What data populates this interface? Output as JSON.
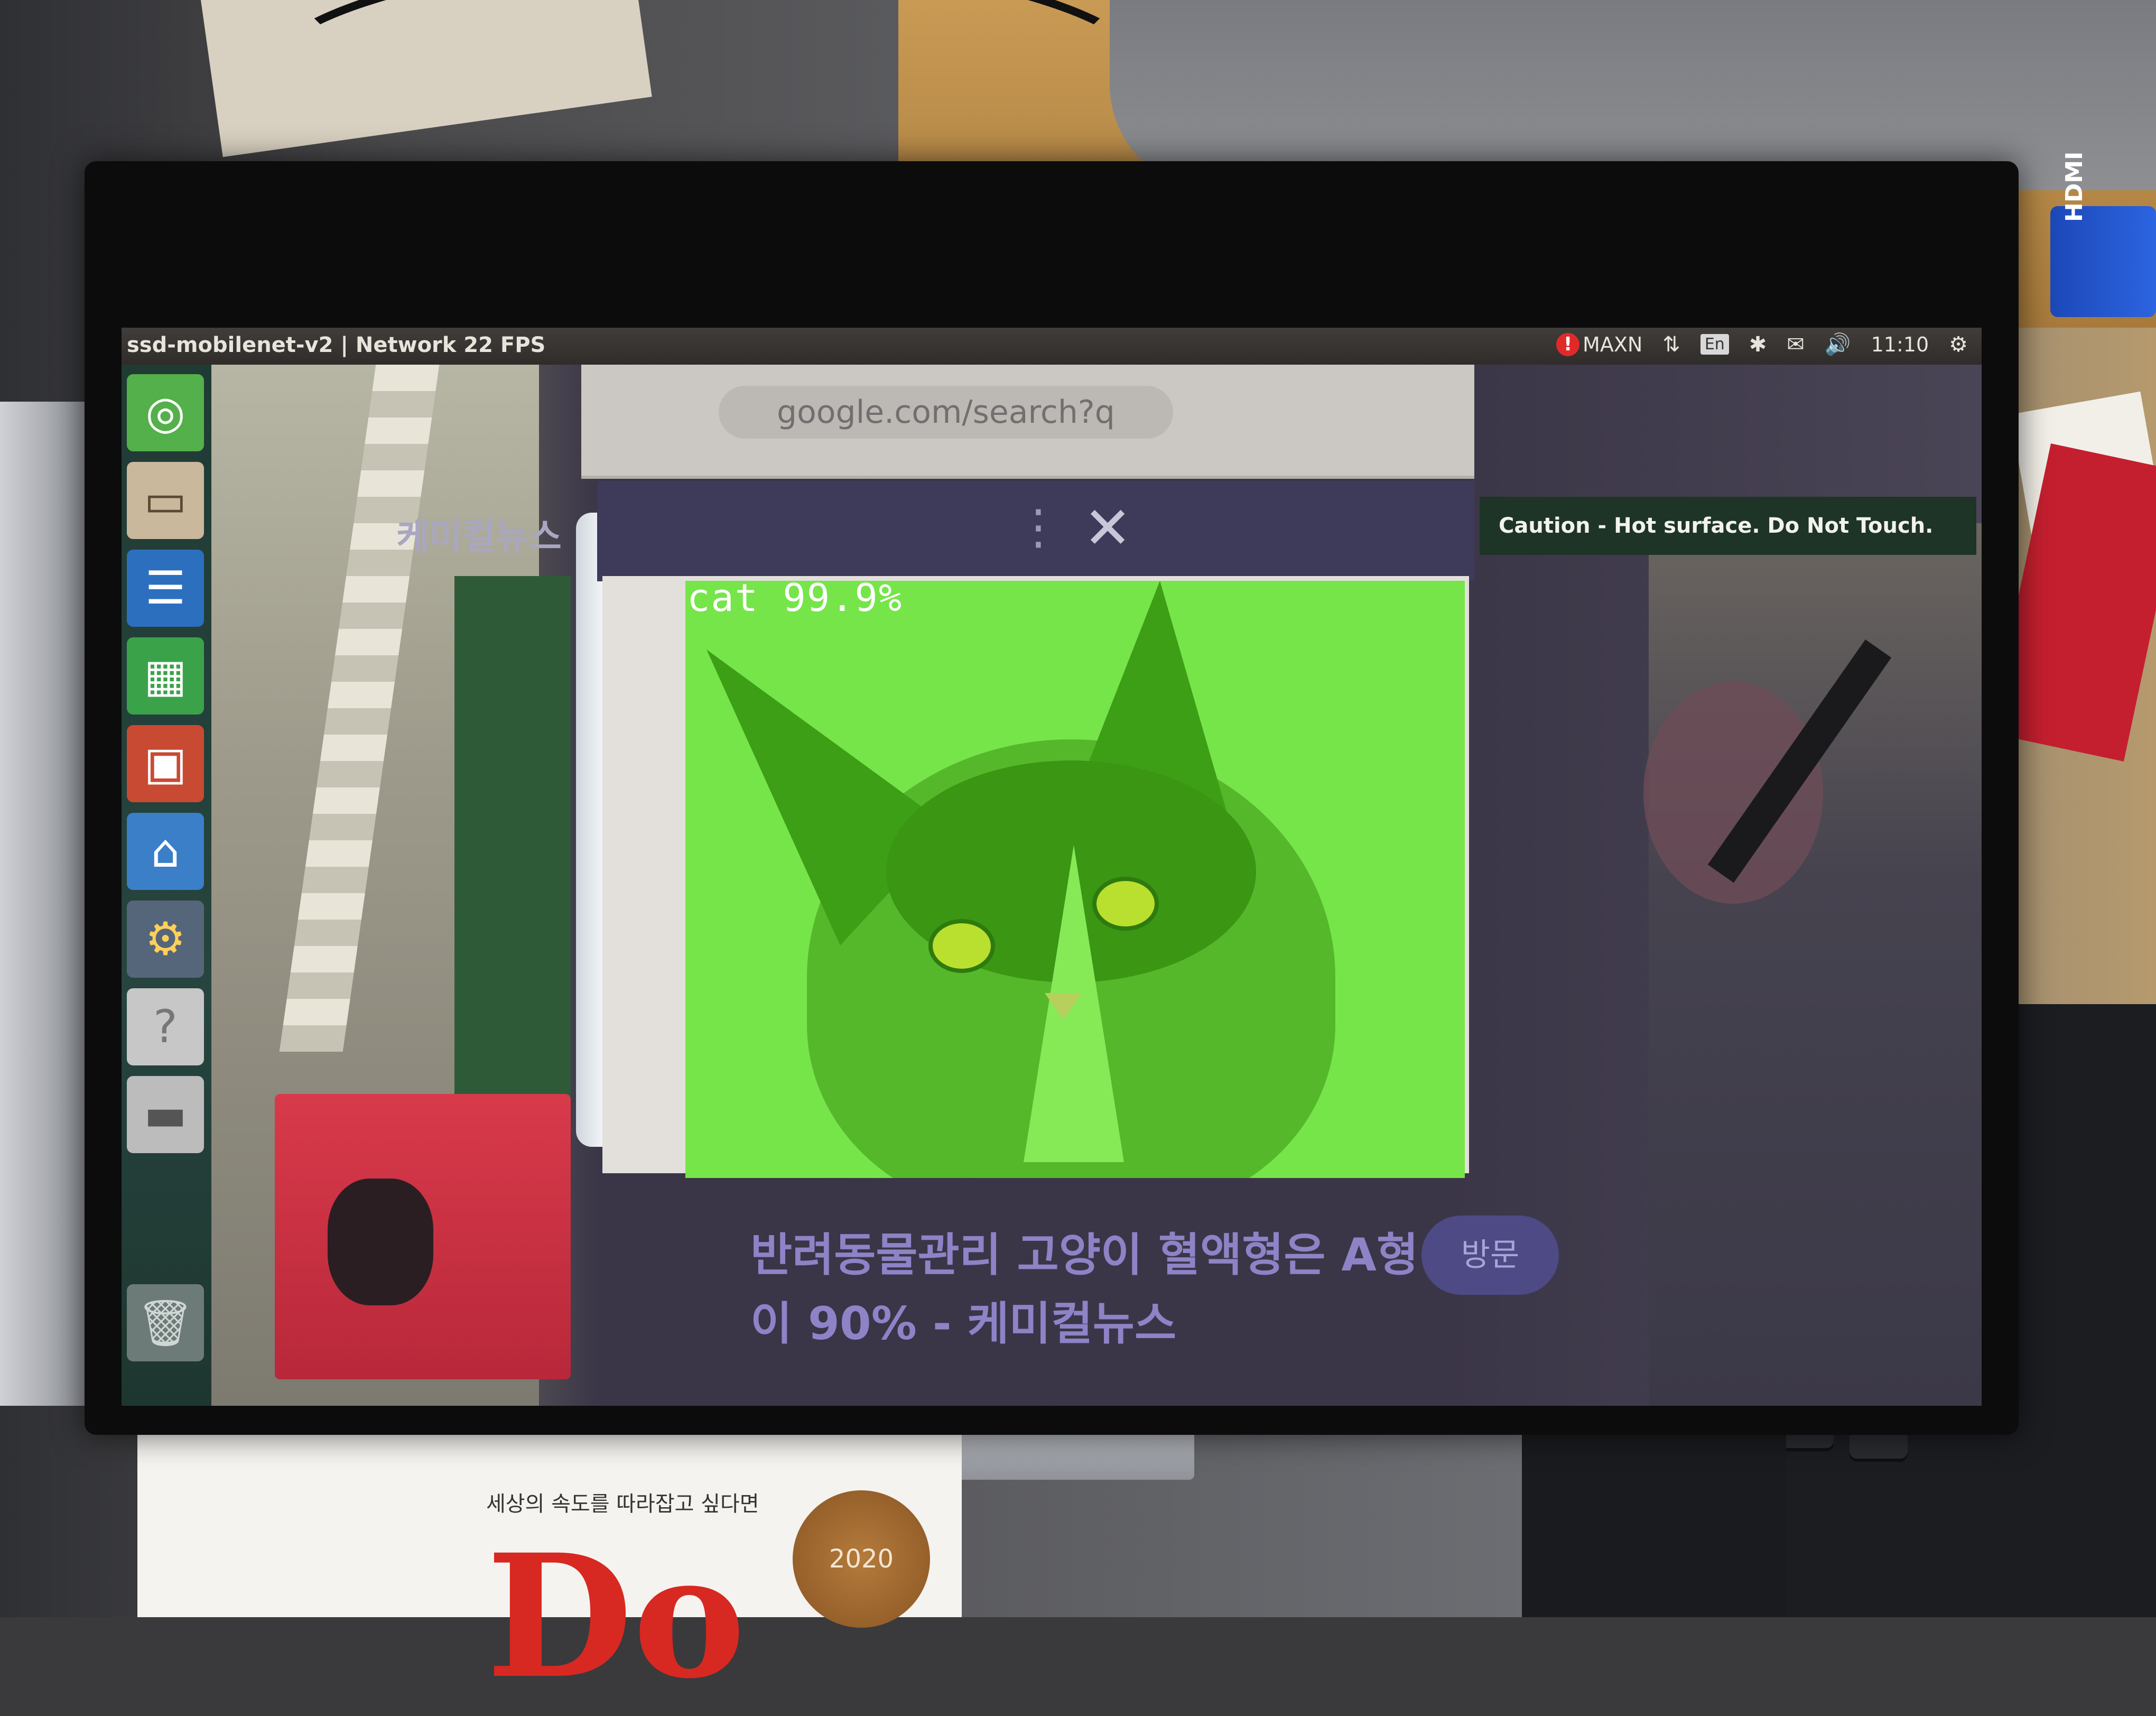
{
  "window": {
    "title": "ssd-mobilenet-v2 | Network 22 FPS"
  },
  "panel": {
    "power_mode": "MAXN",
    "keyboard_layout": "En",
    "clock": "11:10",
    "alert_icon": "!",
    "indicators": [
      "network-icon",
      "bluetooth-icon",
      "mail-icon",
      "volume-icon",
      "gear-icon"
    ]
  },
  "launcher": {
    "items": [
      {
        "name": "dash",
        "glyph": "◎"
      },
      {
        "name": "files",
        "glyph": "▭"
      },
      {
        "name": "writer",
        "glyph": "☰"
      },
      {
        "name": "calc",
        "glyph": "▦"
      },
      {
        "name": "impress",
        "glyph": "▣"
      },
      {
        "name": "software",
        "glyph": "⌂"
      },
      {
        "name": "settings",
        "glyph": "⚙"
      },
      {
        "name": "help",
        "glyph": "?"
      },
      {
        "name": "drive",
        "glyph": "▬"
      },
      {
        "name": "trash",
        "glyph": "🗑"
      }
    ]
  },
  "feed": {
    "browser_url": "google.com/search?q",
    "app_header_title": "케미컬뉴스",
    "detection": {
      "label": "cat 99.9%",
      "class": "cat",
      "confidence": 99.9,
      "color": "#76e54a"
    },
    "headline": "반려동물관리 고양이 혈액형은 A형이 90% - 케미컬뉴스",
    "visit_button": "방문",
    "tooltip": "Caution - Hot surface. Do Not Touch."
  },
  "desk": {
    "hdmi_label": "HDMI",
    "book_text": "세상의 속도를 따라잡고 싶다면",
    "book_title": "Do",
    "seal_text": "2020"
  }
}
